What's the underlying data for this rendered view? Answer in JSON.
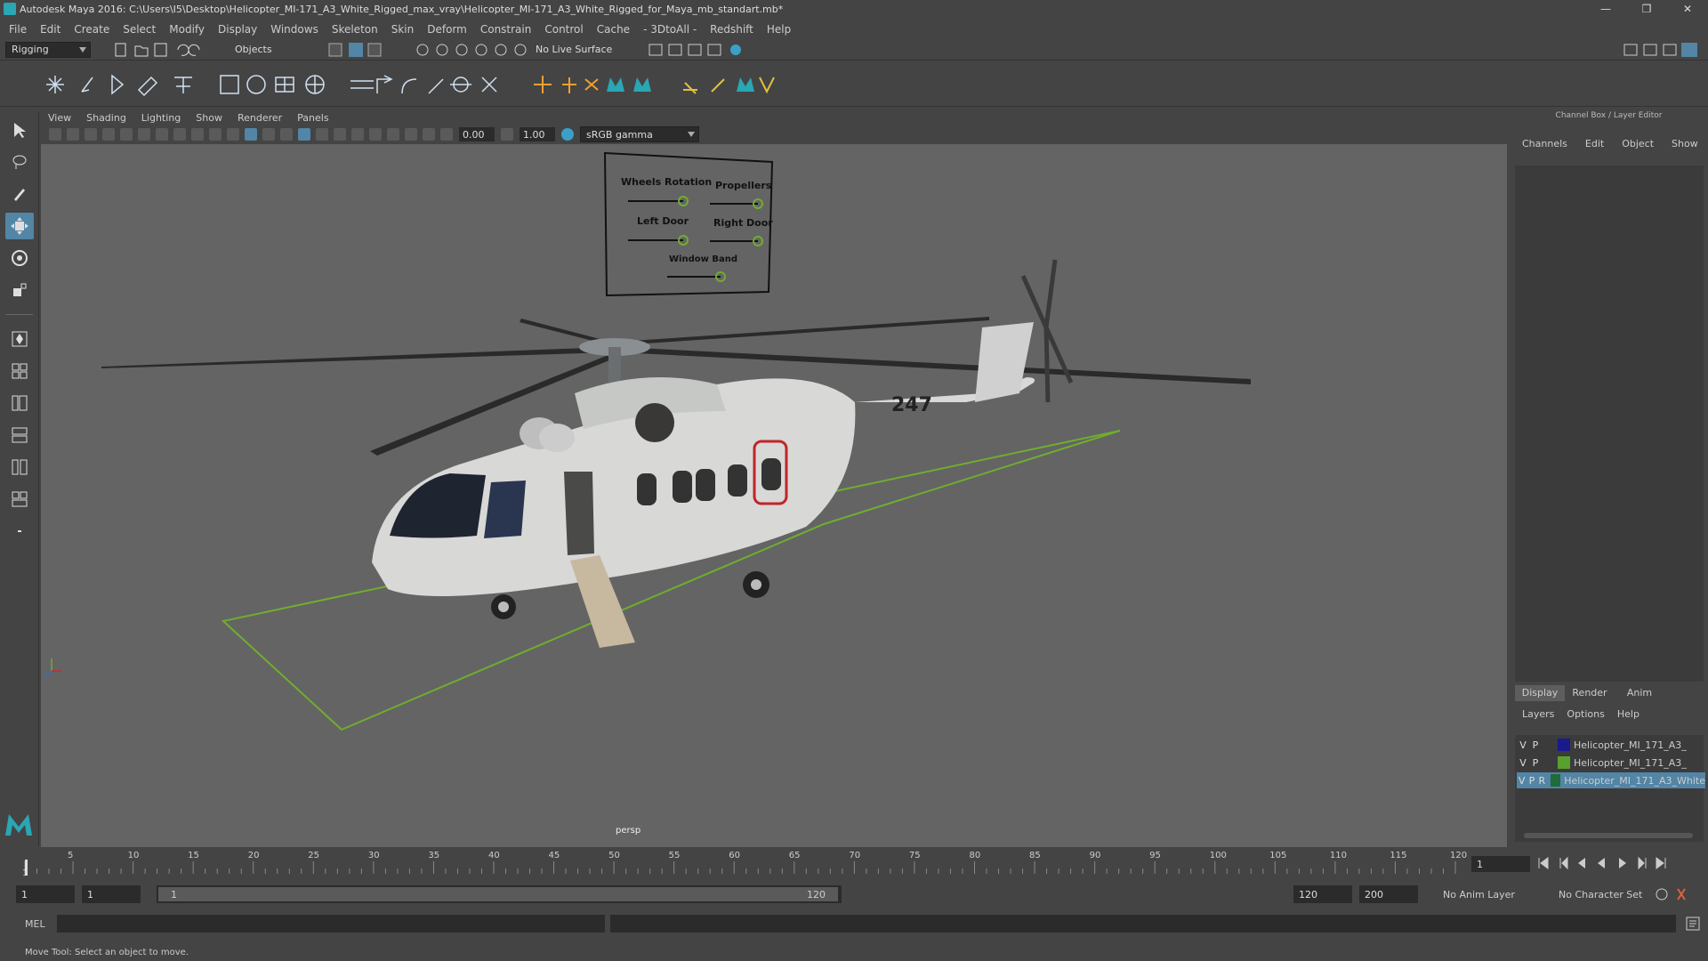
{
  "window": {
    "title": "Autodesk Maya 2016: C:\\Users\\I5\\Desktop\\Helicopter_MI-171_A3_White_Rigged_max_vray\\Helicopter_MI-171_A3_White_Rigged_for_Maya_mb_standart.mb*",
    "minimize": "—",
    "restore": "❐",
    "close": "✕"
  },
  "menubar": [
    "File",
    "Edit",
    "Create",
    "Select",
    "Modify",
    "Display",
    "Windows",
    "Skeleton",
    "Skin",
    "Deform",
    "Constrain",
    "Control",
    "Cache",
    "- 3DtoAll -",
    "Redshift",
    "Help"
  ],
  "statusline": {
    "menuset": "Rigging",
    "objects_label": "Objects",
    "live_surface": "No Live Surface"
  },
  "viewport_menu": [
    "View",
    "Shading",
    "Lighting",
    "Show",
    "Renderer",
    "Panels"
  ],
  "viewport_toolbar": {
    "exposure": "0.00",
    "gamma": "1.00",
    "colorspace": "sRGB gamma"
  },
  "viewport": {
    "camera_label": "persp",
    "tail_number": "247",
    "control_panel": {
      "labels": [
        "Wheels Rotation",
        "Propellers",
        "Left Door",
        "Right Door",
        "Window Band"
      ]
    }
  },
  "channel_box": {
    "header": "Channel Box / Layer Editor",
    "tabs": [
      "Channels",
      "Edit",
      "Object",
      "Show"
    ]
  },
  "layer_editor": {
    "tabs": [
      "Display",
      "Render",
      "Anim"
    ],
    "menu": [
      "Layers",
      "Options",
      "Help"
    ],
    "layers": [
      {
        "v": "V",
        "p": "P",
        "r": "",
        "name": "Helicopter_MI_171_A3_",
        "color": "#1a1a8c",
        "selected": false
      },
      {
        "v": "V",
        "p": "P",
        "r": "",
        "name": "Helicopter_MI_171_A3_",
        "color": "#5aa02c",
        "selected": false
      },
      {
        "v": "V",
        "p": "P",
        "r": "R",
        "name": "Helicopter_MI_171_A3_White",
        "color": "#1f6b3a",
        "selected": true
      }
    ]
  },
  "timeline": {
    "ticks": [
      "1",
      "5",
      "10",
      "15",
      "20",
      "25",
      "30",
      "35",
      "40",
      "45",
      "50",
      "55",
      "60",
      "65",
      "70",
      "75",
      "80",
      "85",
      "90",
      "95",
      "100",
      "105",
      "110",
      "115",
      "120"
    ],
    "current_frame": "1"
  },
  "range": {
    "start": "1",
    "playback_start": "1",
    "slider_start": "1",
    "slider_end": "120",
    "playback_end": "120",
    "end": "200",
    "anim_layer": "No Anim Layer",
    "character_set": "No Character Set"
  },
  "command_line": {
    "language": "MEL"
  },
  "help_line": "Move Tool: Select an object to move.",
  "colors": {
    "accent": "#5285a6",
    "ground_plane": "#6fae2e",
    "viewport_bg": "#646464"
  }
}
